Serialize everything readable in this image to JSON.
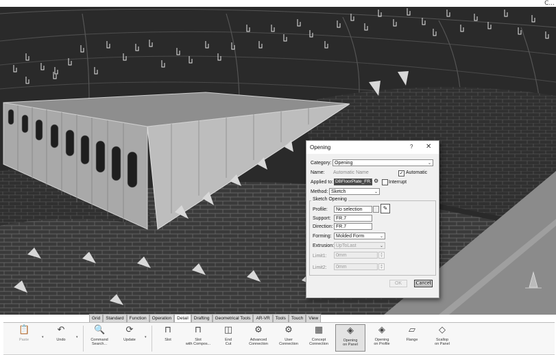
{
  "window": {
    "corner_glyph": "C..."
  },
  "dialog": {
    "title": "Opening",
    "help": "?",
    "close": "✕",
    "category_label": "Category:",
    "category_value": "Opening",
    "name_label": "Name:",
    "name_value": "Automatic Name",
    "automatic_label": "Automatic",
    "applied_label": "Applied to:",
    "applied_value": "DBFloorPlate_FR.7",
    "interrupt_label": "Interrupt",
    "method_label": "Method:",
    "method_value": "Sketch",
    "group_title": "Sketch Opening",
    "profile_label": "Profile:",
    "profile_value": "No selection",
    "support_label": "Support:",
    "support_value": "FR.7",
    "direction_label": "Direction:",
    "direction_value": "FR.7",
    "forming_label": "Forming:",
    "forming_value": "Molded Form",
    "extrusion_label": "Extrusion:",
    "extrusion_value": "UpToLast",
    "limit1_label": "Limit1:",
    "limit1_value": "0mm",
    "limit2_label": "Limit2:",
    "limit2_value": "0mm",
    "ok_label": "OK",
    "cancel_label": "Cancel"
  },
  "ribbon": {
    "tabs": [
      "Grid",
      "Standard",
      "Function",
      "Operation",
      "Detail",
      "Drafting",
      "Geometrical Tools",
      "AR-VR",
      "Tools",
      "Touch",
      "View"
    ],
    "active_tab": "Detail",
    "commands": {
      "paste": "Paste",
      "undo": "Undo",
      "command_search": "Command\nSearch...",
      "update": "Update",
      "slot": "Slot",
      "slot_compos": "Slot\nwith Compos...",
      "end_cut": "End\nCut",
      "adv_conn": "Advanced\nConnection",
      "user_conn": "User\nConnection",
      "concept_conn": "Concept\nConnection",
      "opening_panel": "Opening\non Panel",
      "opening_profile": "Opening\non Profile",
      "flange": "Flange",
      "scallop": "Scallop\non Panel"
    }
  }
}
